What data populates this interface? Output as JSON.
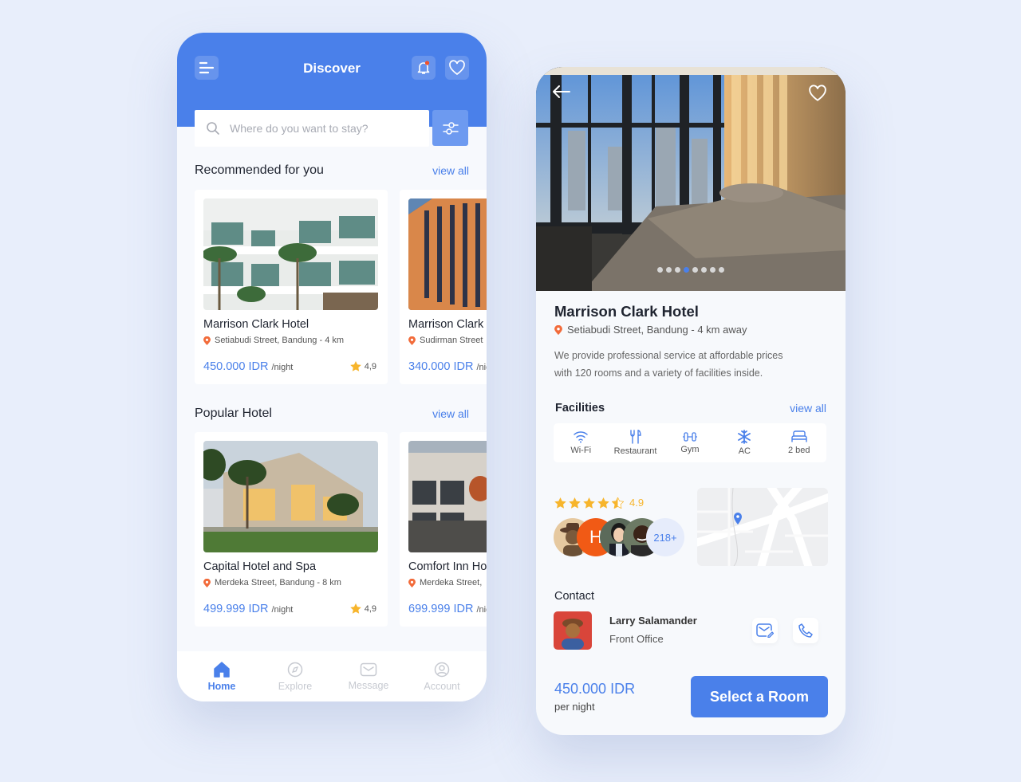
{
  "colors": {
    "accent": "#4a80ea",
    "location_pin": "#f26b3a",
    "star": "#f7b52c",
    "background": "#e8eefb"
  },
  "discover": {
    "header": {
      "menu_icon": "menu-icon",
      "title": "Discover",
      "bell_icon": "bell-icon",
      "heart_icon": "heart-icon"
    },
    "search": {
      "placeholder": "Where do you want to stay?",
      "value": "",
      "filter_icon": "sliders-icon"
    },
    "recommended": {
      "title": "Recommended for you",
      "view_all": "view all",
      "items": [
        {
          "name": "Marrison Clark Hotel",
          "location": "Setiabudi Street, Bandung - 4 km",
          "price": "450.000 IDR",
          "unit": "/night",
          "rating": "4,9"
        },
        {
          "name": "Marrison Clark Hotel",
          "location": "Sudirman Street",
          "price": "340.000 IDR",
          "unit": "/night",
          "rating": ""
        }
      ]
    },
    "popular": {
      "title": "Popular Hotel",
      "view_all": "view all",
      "items": [
        {
          "name": "Capital Hotel and Spa",
          "location": "Merdeka Street, Bandung - 8 km",
          "price": "499.999 IDR",
          "unit": "/night",
          "rating": "4,9"
        },
        {
          "name": "Comfort Inn Hotel",
          "location": "Merdeka Street,",
          "price": "699.999 IDR",
          "unit": "/night",
          "rating": ""
        }
      ]
    },
    "nav": [
      {
        "label": "Home",
        "icon": "home-icon",
        "active": true
      },
      {
        "label": "Explore",
        "icon": "compass-icon",
        "active": false
      },
      {
        "label": "Message",
        "icon": "mail-icon",
        "active": false
      },
      {
        "label": "Account",
        "icon": "user-icon",
        "active": false
      }
    ]
  },
  "detail": {
    "hero": {
      "back_icon": "arrow-left-icon",
      "favorite_icon": "heart-icon",
      "slide_count": 8,
      "active_slide": 4
    },
    "name": "Marrison Clark Hotel",
    "location": "Setiabudi Street, Bandung - 4 km away",
    "description_line1": "We provide professional service at affordable prices",
    "description_line2": "with 120 rooms and a variety of facilities inside.",
    "facilities": {
      "title": "Facilities",
      "view_all": "view all",
      "items": [
        {
          "label": "Wi-Fi",
          "icon": "wifi-icon"
        },
        {
          "label": "Restaurant",
          "icon": "fork-knife-icon"
        },
        {
          "label": "Gym",
          "icon": "dumbbell-icon"
        },
        {
          "label": "AC",
          "icon": "snowflake-icon"
        },
        {
          "label": "2 bed",
          "icon": "bed-icon"
        }
      ]
    },
    "rating": {
      "value": "4.9",
      "stars": 4.5,
      "reviewers_more": "218+",
      "avatar_letter": "H"
    },
    "contact": {
      "title": "Contact",
      "name": "Larry Salamander",
      "role": "Front Office",
      "message_icon": "mail-edit-icon",
      "phone_icon": "phone-icon"
    },
    "footer": {
      "price": "450.000 IDR",
      "unit": "per night",
      "cta": "Select a Room"
    }
  }
}
